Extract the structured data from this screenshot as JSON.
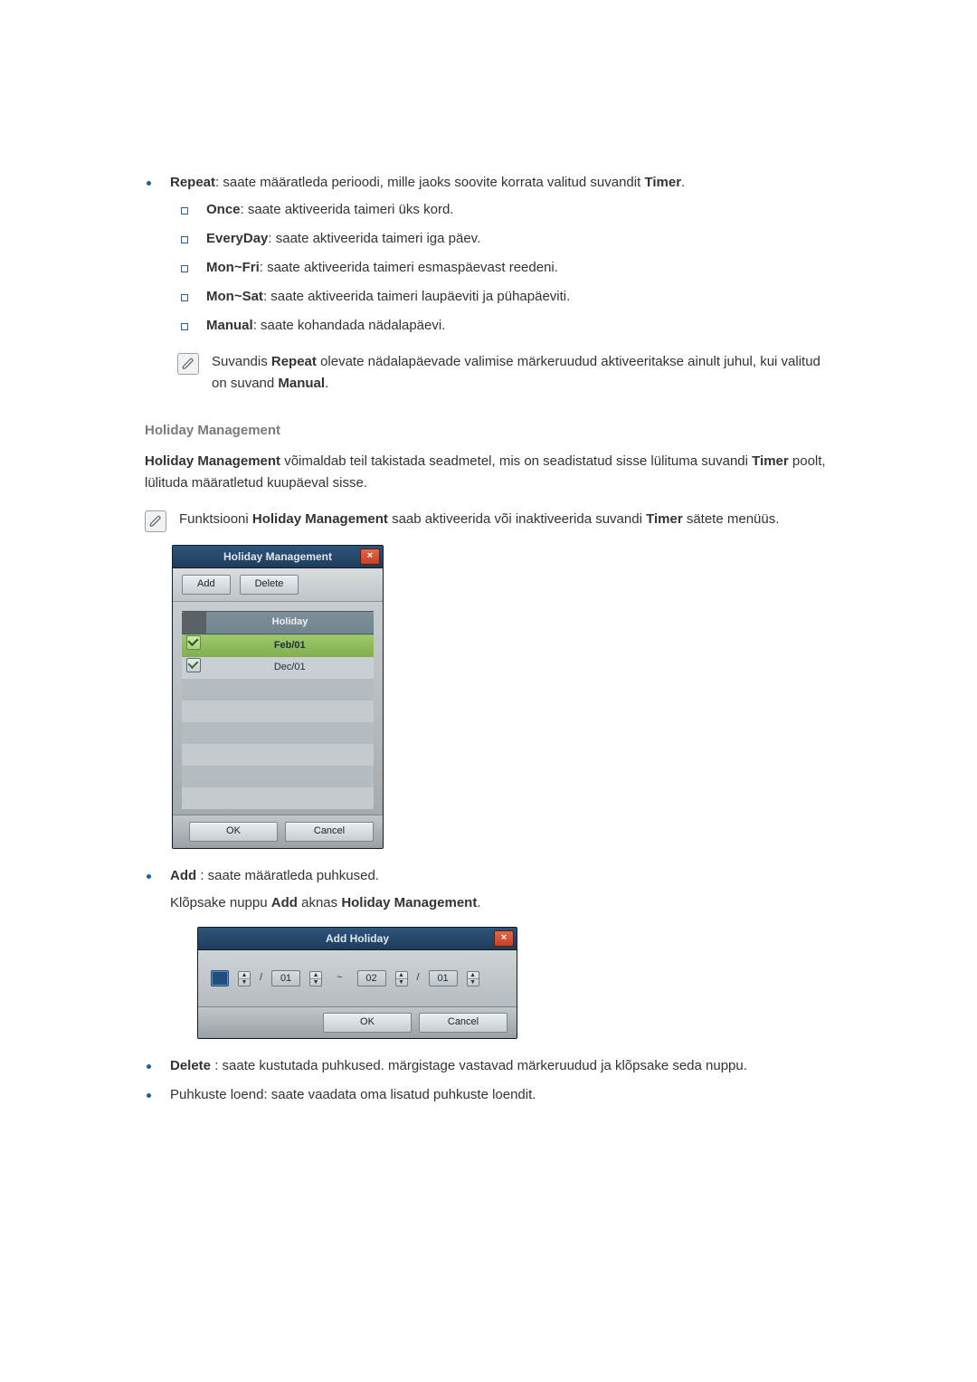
{
  "repeat": {
    "title": "Repeat",
    "intro_after_title": ": saate määratleda perioodi, mille jaoks soovite korrata valitud suvandit ",
    "intro_after_timer": "Timer",
    "intro_tail": ".",
    "items": [
      {
        "label": "Once",
        "desc": ": saate aktiveerida taimeri üks kord."
      },
      {
        "label": "EveryDay",
        "desc": ": saate aktiveerida taimeri iga päev."
      },
      {
        "label": "Mon~Fri",
        "desc": ": saate aktiveerida taimeri esmaspäevast reedeni."
      },
      {
        "label": "Mon~Sat",
        "desc": ": saate aktiveerida taimeri laupäeviti ja pühapäeviti."
      },
      {
        "label": "Manual",
        "desc": ": saate kohandada nädalapäevi."
      }
    ],
    "note_pre": "Suvandis ",
    "note_b1": "Repeat",
    "note_mid": " olevate nädalapäevade valimise märkeruudud aktiveeritakse ainult juhul, kui valitud on suvand ",
    "note_b2": "Manual",
    "note_tail": "."
  },
  "hm": {
    "heading": "Holiday Management",
    "para_b1": "Holiday Management",
    "para_mid": " võimaldab teil takistada seadmetel, mis on seadistatud sisse lülituma suvandi ",
    "para_b2": "Timer",
    "para_tail": " poolt, lülituda määratletud kuupäeval sisse.",
    "note_pre": "Funktsiooni ",
    "note_b1": "Holiday Management",
    "note_mid": " saab aktiveerida või inaktiveerida suvandi ",
    "note_b2": "Timer",
    "note_tail": " sätete menüüs.",
    "dlg": {
      "title": "Holiday Management",
      "close": "×",
      "add_btn": "Add",
      "delete_btn": "Delete",
      "col_holiday": "Holiday",
      "rows": [
        {
          "date": "Feb/01",
          "selected": true
        },
        {
          "date": "Dec/01",
          "selected": false
        }
      ],
      "ok": "OK",
      "cancel": "Cancel"
    }
  },
  "bullets2": {
    "add_b": "Add",
    "add_desc": " : saate määratleda puhkused.",
    "add_line2_pre": "Klõpsake nuppu ",
    "add_line2_b1": "Add",
    "add_line2_mid": " aknas ",
    "add_line2_b2": "Holiday Management",
    "add_line2_tail": ".",
    "delete_b": "Delete",
    "delete_desc": " : saate kustutada puhkused. märgistage vastavad märkeruudud ja klõpsake seda nuppu.",
    "list_desc": "Puhkuste loend: saate vaadata oma lisatud puhkuste loendit."
  },
  "ah": {
    "title": "Add Holiday",
    "close": "×",
    "from_month": "",
    "from_day": "01",
    "to_month": "02",
    "to_day": "01",
    "slash": "/",
    "tilde": "~",
    "ok": "OK",
    "cancel": "Cancel"
  }
}
